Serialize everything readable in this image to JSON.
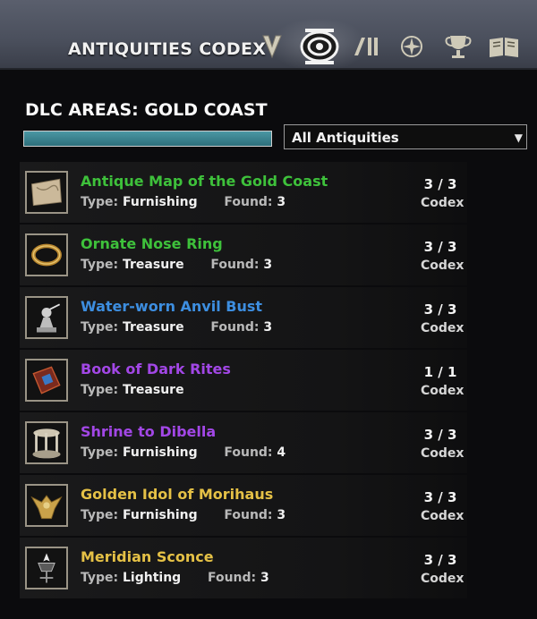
{
  "header": {
    "title": "ANTIQUITIES CODEX",
    "tabs": [
      {
        "icon": "scrying-icon"
      },
      {
        "icon": "codex-eye-icon",
        "active": true
      },
      {
        "icon": "journal-bars-icon"
      },
      {
        "icon": "champion-star-icon"
      },
      {
        "icon": "trophy-icon"
      },
      {
        "icon": "open-book-icon"
      }
    ]
  },
  "area": {
    "title": "DLC AREAS: GOLD COAST",
    "progress": 1.0
  },
  "filter": {
    "selected": "All Antiquities"
  },
  "labels": {
    "type": "Type:",
    "found": "Found:",
    "codex": "Codex"
  },
  "items": [
    {
      "name": "Antique Map of the Gold Coast",
      "color": "#3ec13b",
      "type": "Furnishing",
      "found": "3",
      "count": "3 / 3",
      "icon": "map-icon"
    },
    {
      "name": "Ornate Nose Ring",
      "color": "#3ec13b",
      "type": "Treasure",
      "found": "3",
      "count": "3 / 3",
      "icon": "ring-icon"
    },
    {
      "name": "Water-worn Anvil Bust",
      "color": "#3d8ee0",
      "type": "Treasure",
      "found": "3",
      "count": "3 / 3",
      "icon": "bust-icon"
    },
    {
      "name": "Book of Dark Rites",
      "color": "#a247e6",
      "type": "Treasure",
      "found": "",
      "count": "1 / 1",
      "icon": "dark-book-icon"
    },
    {
      "name": "Shrine to Dibella",
      "color": "#a247e6",
      "type": "Furnishing",
      "found": "4",
      "count": "3 / 3",
      "icon": "shrine-icon"
    },
    {
      "name": "Golden Idol of Morihaus",
      "color": "#e5c146",
      "type": "Furnishing",
      "found": "3",
      "count": "3 / 3",
      "icon": "idol-icon"
    },
    {
      "name": "Meridian Sconce",
      "color": "#e5c146",
      "type": "Lighting",
      "found": "3",
      "count": "3 / 3",
      "icon": "sconce-icon"
    }
  ]
}
